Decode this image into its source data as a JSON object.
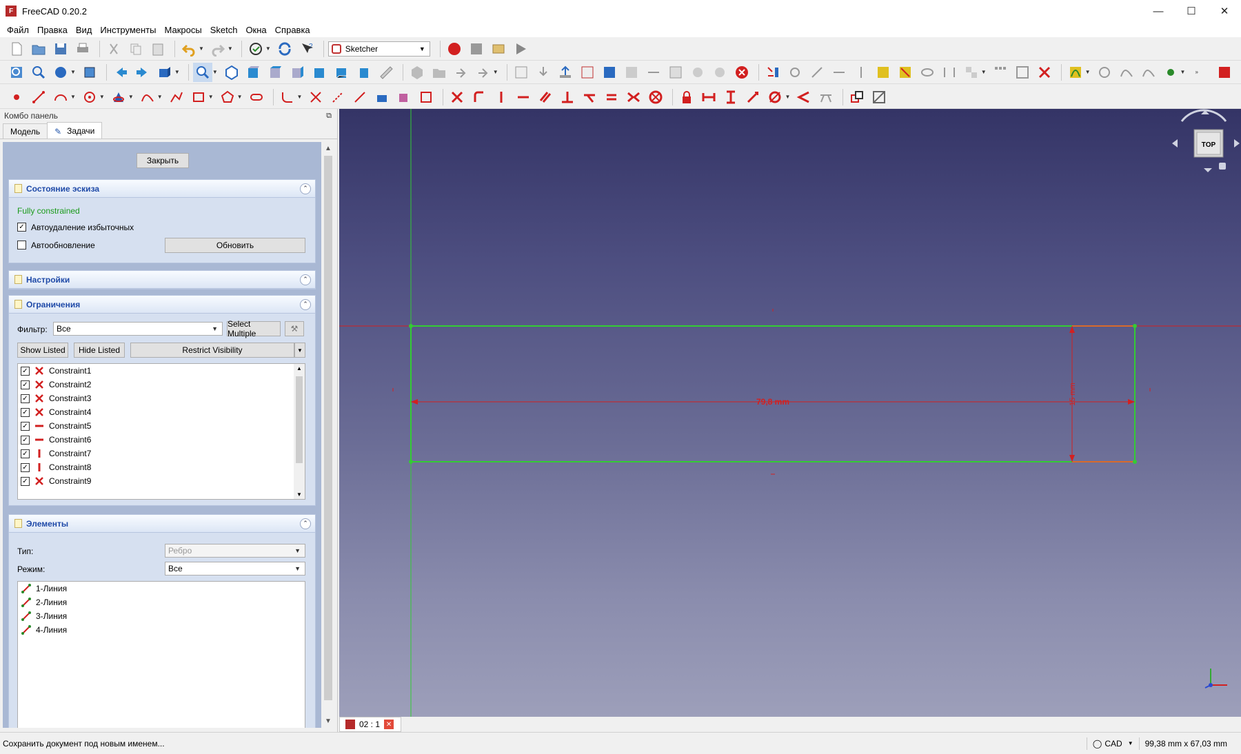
{
  "window": {
    "title": "FreeCAD 0.20.2"
  },
  "menu": [
    "Файл",
    "Правка",
    "Вид",
    "Инструменты",
    "Макросы",
    "Sketch",
    "Окна",
    "Справка"
  ],
  "workbench": {
    "selected": "Sketcher"
  },
  "combo_panel": {
    "title": "Комбо панель",
    "tabs": [
      "Модель",
      "Задачи"
    ],
    "close_label": "Закрыть",
    "sketch_state": {
      "header": "Состояние эскиза",
      "status": "Fully constrained",
      "auto_remove_label": "Автоудаление избыточных",
      "auto_update_label": "Автообновление",
      "update_button": "Обновить"
    },
    "settings": {
      "header": "Настройки"
    },
    "constraints": {
      "header": "Ограничения",
      "filter_label": "Фильтр:",
      "filter_value": "Все",
      "select_multiple": "Select Multiple",
      "show_listed": "Show Listed",
      "hide_listed": "Hide Listed",
      "restrict_visibility": "Restrict Visibility",
      "items": [
        {
          "label": "Constraint1",
          "kind": "coincident"
        },
        {
          "label": "Constraint2",
          "kind": "coincident"
        },
        {
          "label": "Constraint3",
          "kind": "coincident"
        },
        {
          "label": "Constraint4",
          "kind": "coincident"
        },
        {
          "label": "Constraint5",
          "kind": "horizontal"
        },
        {
          "label": "Constraint6",
          "kind": "horizontal"
        },
        {
          "label": "Constraint7",
          "kind": "vertical"
        },
        {
          "label": "Constraint8",
          "kind": "vertical"
        },
        {
          "label": "Constraint9",
          "kind": "coincident"
        }
      ]
    },
    "elements": {
      "header": "Элементы",
      "type_label": "Тип:",
      "type_value": "Ребро",
      "mode_label": "Режим:",
      "mode_value": "Все",
      "items": [
        "1-Линия",
        "2-Линия",
        "3-Линия",
        "4-Линия"
      ]
    }
  },
  "view": {
    "dimension_horizontal": "79,8 mm",
    "dimension_vertical": "15 mm",
    "nav_cube_face": "TOP",
    "tab_label": "02 : 1"
  },
  "status_bar": {
    "message": "Сохранить документ под новым именем...",
    "nav_style": "CAD",
    "dimensions": "99,38 mm x 67,03 mm"
  },
  "colors": {
    "accent_red": "#d22020",
    "sketch_green": "#33cc33",
    "header_blue": "#1f4aa8",
    "status_green": "#1a9a1a"
  }
}
